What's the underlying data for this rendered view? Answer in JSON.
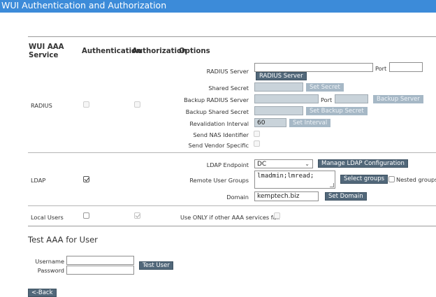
{
  "header": {
    "title": "WUI Authentication and Authorization"
  },
  "table": {
    "col_service": "WUI AAA Service",
    "col_authentication": "Authentication",
    "col_authorization": "Authorization",
    "col_options": "Options"
  },
  "radius": {
    "label": "RADIUS",
    "server_label": "RADIUS Server",
    "server_value": "",
    "port_label": "Port",
    "port_value": "",
    "server_button": "RADIUS Server",
    "secret_label": "Shared Secret",
    "secret_value": "",
    "secret_button": "Set Secret",
    "backup_server_label": "Backup RADIUS Server",
    "backup_port_label": "Port",
    "backup_server_button": "Backup Server",
    "backup_secret_label": "Backup Shared Secret",
    "backup_secret_button": "Set Backup Secret",
    "revalidation_label": "Revalidation Interval",
    "revalidation_value": "60",
    "interval_button": "Set Interval",
    "nas_label": "Send NAS Identifier",
    "vendor_label": "Send Vendor Specific"
  },
  "ldap": {
    "label": "LDAP",
    "endpoint_label": "LDAP Endpoint",
    "endpoint_value": "DC",
    "manage_button": "Manage LDAP Configuration",
    "groups_label": "Remote User Groups",
    "groups_value": "lmadmin;lmread;",
    "select_groups_button": "Select groups",
    "nested_groups_label": "Nested groups",
    "domain_label": "Domain",
    "domain_value": "kemptech.biz",
    "set_domain_button": "Set Domain"
  },
  "local": {
    "label": "Local Users",
    "only_if_fail_label": "Use ONLY if other AAA services fail"
  },
  "test": {
    "title": "Test AAA for User",
    "username_label": "Username",
    "username_value": "",
    "password_label": "Password",
    "password_value": "",
    "test_button": "Test User"
  },
  "back_button": "<-Back"
}
